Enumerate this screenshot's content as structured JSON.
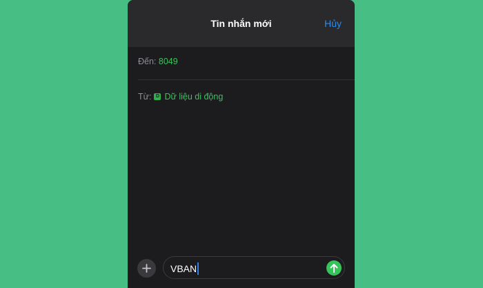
{
  "nav": {
    "title": "Tin nhắn mới",
    "cancel_label": "Hủy"
  },
  "to": {
    "label": "Đến:",
    "value": "8049"
  },
  "from": {
    "label": "Từ:",
    "sim_badge": "D",
    "value": "Dữ liệu di động"
  },
  "composer": {
    "text": "VBAN",
    "add_icon": "plus-icon",
    "send_icon": "arrow-up-icon"
  },
  "colors": {
    "background": "#47be84",
    "accent_blue": "#2f8ae8",
    "accent_green": "#3cc35f"
  }
}
